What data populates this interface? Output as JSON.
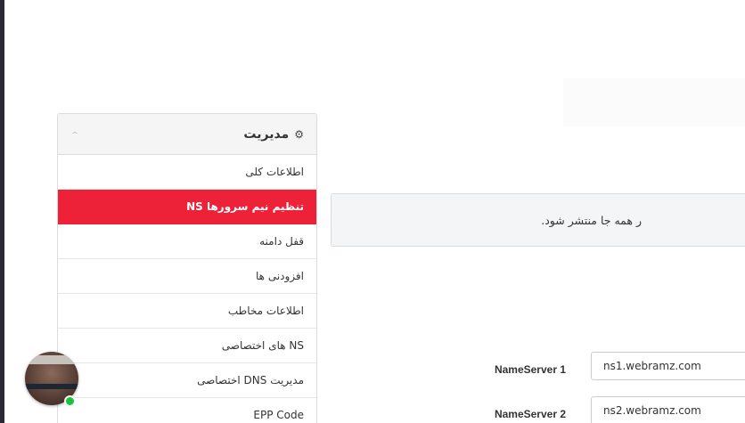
{
  "sidebar": {
    "title": "مدیریت",
    "items": [
      {
        "label": "اطلاعات کلی"
      },
      {
        "label": "تنظیم نیم سرورها NS"
      },
      {
        "label": "قفل دامنه"
      },
      {
        "label": "افزودنی ها"
      },
      {
        "label": "اطلاعات مخاطب"
      },
      {
        "label": "NS های اختصاصی"
      },
      {
        "label": "مدیریت DNS اختصاصی"
      },
      {
        "label": "EPP Code"
      }
    ],
    "active_index": 1
  },
  "alert": {
    "text": "ر همه جا منتشر شود."
  },
  "form": {
    "ns1": {
      "label": "NameServer 1",
      "value": "ns1.webramz.com"
    },
    "ns2": {
      "label": "NameServer 2",
      "value": "ns2.webramz.com"
    }
  },
  "colors": {
    "active_item": "#ed2138",
    "online_status": "#19c43c"
  },
  "icons": {
    "panel_header": "gear-icon",
    "collapse": "chevron-up-icon"
  }
}
